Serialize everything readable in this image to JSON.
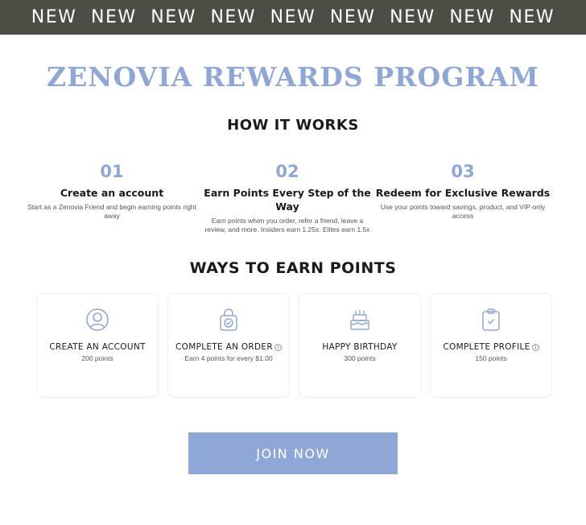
{
  "banner": {
    "items": [
      "NEW",
      "NEW",
      "NEW",
      "NEW",
      "NEW",
      "NEW",
      "NEW",
      "NEW",
      "NEW"
    ]
  },
  "page_title": "ZENOVIA REWARDS PROGRAM",
  "how_it_works": {
    "heading": "HOW IT WORKS",
    "steps": [
      {
        "number": "01",
        "title": "Create an account",
        "description": "Start as a Zenovia Friend and begin earning points right away"
      },
      {
        "number": "02",
        "title": "Earn Points Every Step of the Way",
        "description": "Earn points when you order, refer a friend, leave a review, and more. Insiders earn 1.25x. Elites earn 1.5x"
      },
      {
        "number": "03",
        "title": "Redeem for Exclusive Rewards",
        "description": "Use your points toward savings, product, and VIP-only access"
      }
    ]
  },
  "ways_to_earn": {
    "heading": "WAYS TO EARN POINTS",
    "cards": [
      {
        "icon": "user-circle-icon",
        "label": "CREATE AN ACCOUNT",
        "points": "200 points",
        "info": false
      },
      {
        "icon": "shopping-bag-icon",
        "label": "COMPLETE AN ORDER",
        "points": "Earn 4 points for every $1.00",
        "info": true
      },
      {
        "icon": "birthday-cake-icon",
        "label": "HAPPY BIRTHDAY",
        "points": "300 points",
        "info": false
      },
      {
        "icon": "clipboard-check-icon",
        "label": "COMPLETE PROFILE",
        "points": "150 points",
        "info": true
      }
    ]
  },
  "join_button": "JOIN NOW",
  "colors": {
    "banner_bg": "#4c4d45",
    "accent": "#8fa7d6",
    "text": "#1a1a1a"
  }
}
